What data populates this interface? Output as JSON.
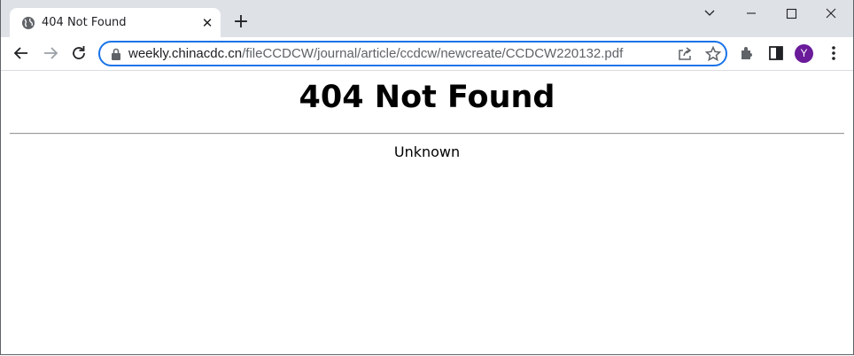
{
  "tab": {
    "title": "404 Not Found",
    "favicon": "globe-icon",
    "close_glyph": "✕"
  },
  "toolbar": {
    "new_tab_glyph": "+",
    "url_host": "weekly.chinacdc.cn",
    "url_path": "/fileCCDCW/journal/article/ccdcw/newcreate/CCDCW220132.pdf",
    "avatar_letter": "Y",
    "avatar_color": "#6a1b9a",
    "accent_color": "#1a73e8"
  },
  "page": {
    "heading": "404 Not Found",
    "server_text": "Unknown"
  }
}
